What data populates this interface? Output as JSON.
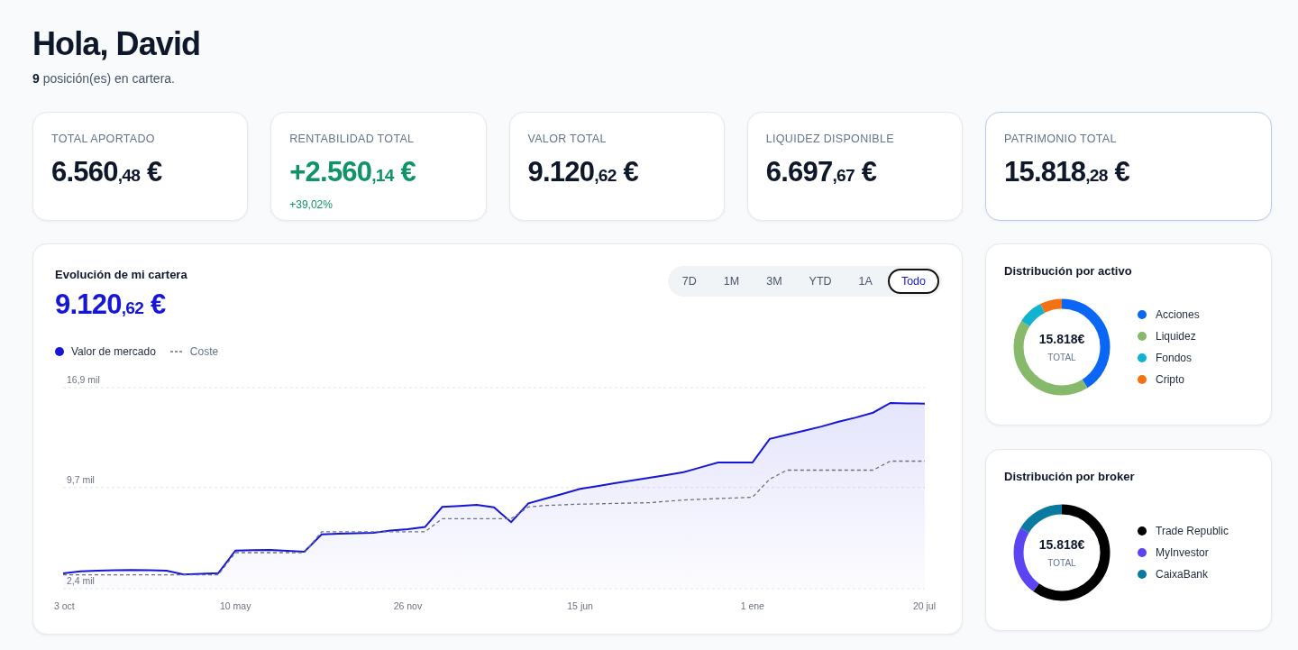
{
  "greeting": {
    "title": "Hola, David",
    "count": "9",
    "subtitle": "posición(es) en cartera."
  },
  "summary_cards": [
    {
      "label": "TOTAL APORTADO",
      "kind": "neutral",
      "highlighted": false,
      "amount": {
        "integer": "6.560",
        "decimals": ",48",
        "currency": "€"
      }
    },
    {
      "label": "RENTABILIDAD TOTAL",
      "kind": "positive",
      "highlighted": false,
      "amount": {
        "integer": "+2.560",
        "decimals": ",14",
        "currency": "€"
      },
      "change": "+39,02%"
    },
    {
      "label": "VALOR TOTAL",
      "kind": "neutral",
      "highlighted": false,
      "amount": {
        "integer": "9.120",
        "decimals": ",62",
        "currency": "€"
      }
    },
    {
      "label": "LIQUIDEZ DISPONIBLE",
      "kind": "neutral",
      "highlighted": false,
      "amount": {
        "integer": "6.697",
        "decimals": ",67",
        "currency": "€"
      }
    },
    {
      "label": "PATRIMONIO TOTAL",
      "kind": "neutral",
      "highlighted": true,
      "amount": {
        "integer": "15.818",
        "decimals": ",28",
        "currency": "€"
      }
    }
  ],
  "evolution": {
    "title": "Evolución de mi cartera",
    "amount": {
      "integer": "9.120",
      "decimals": ",62",
      "currency": "€"
    },
    "ranges": [
      {
        "label": "7D",
        "selected": false
      },
      {
        "label": "1M",
        "selected": false
      },
      {
        "label": "3M",
        "selected": false
      },
      {
        "label": "YTD",
        "selected": false
      },
      {
        "label": "1A",
        "selected": false
      },
      {
        "label": "Todo",
        "selected": true
      }
    ],
    "chart_data": {
      "type": "line",
      "categories": [
        "3 oct",
        null,
        null,
        null,
        null,
        null,
        null,
        null,
        null,
        null,
        "10 may",
        null,
        null,
        null,
        null,
        null,
        null,
        null,
        null,
        null,
        "26 nov",
        null,
        null,
        null,
        null,
        null,
        null,
        null,
        null,
        null,
        "15 jun",
        null,
        null,
        null,
        null,
        null,
        null,
        null,
        null,
        null,
        "1 ene",
        null,
        null,
        null,
        null,
        null,
        null,
        null,
        null,
        null,
        "20 jul"
      ],
      "series": [
        {
          "name": "Valor de mercado",
          "color": "#1616d6",
          "type": "area",
          "values": [
            3.5,
            3.65,
            3.7,
            3.73,
            3.75,
            3.73,
            3.7,
            3.43,
            3.47,
            3.52,
            5.15,
            5.18,
            5.19,
            5.13,
            5.07,
            6.32,
            6.36,
            6.4,
            6.44,
            6.6,
            6.7,
            6.85,
            8.3,
            8.37,
            8.44,
            8.27,
            7.2,
            8.55,
            8.9,
            9.25,
            9.6,
            9.8,
            10.0,
            10.2,
            10.4,
            10.6,
            10.8,
            11.15,
            11.5,
            11.5,
            11.5,
            13.2,
            13.5,
            13.8,
            14.1,
            14.45,
            14.75,
            15.1,
            15.8,
            15.77,
            15.75
          ]
        },
        {
          "name": "Coste",
          "color": "#6b7280",
          "type": "line",
          "line_style": "dashed",
          "values": [
            3.4,
            3.4,
            3.4,
            3.4,
            3.4,
            3.4,
            3.4,
            3.4,
            3.4,
            3.4,
            5.0,
            5.0,
            5.0,
            5.0,
            5.0,
            6.5,
            6.5,
            6.5,
            6.5,
            6.5,
            6.5,
            6.5,
            7.45,
            7.45,
            7.45,
            7.45,
            7.45,
            8.3,
            8.4,
            8.45,
            8.5,
            8.52,
            8.55,
            8.58,
            8.6,
            8.7,
            8.8,
            8.85,
            8.9,
            8.95,
            9.0,
            10.3,
            10.95,
            10.95,
            10.95,
            10.95,
            10.95,
            10.95,
            11.6,
            11.6,
            11.6
          ]
        }
      ],
      "ylim": [
        2.4,
        16.9
      ],
      "grid": true,
      "yticks": [
        {
          "value": 2.4,
          "label": "2,4 mil"
        },
        {
          "value": 9.7,
          "label": "9,7 mil"
        },
        {
          "value": 16.9,
          "label": "16,9 mil"
        }
      ]
    }
  },
  "distributions": [
    {
      "title": "Distribución por activo",
      "center_value": "15.818€",
      "center_label": "TOTAL",
      "legend": [
        {
          "label": "Acciones",
          "color": "#0a66f5"
        },
        {
          "label": "Liquidez",
          "color": "#86b96a"
        },
        {
          "label": "Fondos",
          "color": "#10b4cf"
        },
        {
          "label": "Cripto",
          "color": "#f47216"
        }
      ]
    },
    {
      "title": "Distribución por broker",
      "center_value": "15.818€",
      "center_label": "TOTAL",
      "legend": [
        {
          "label": "Trade Republic",
          "color": "#000000"
        },
        {
          "label": "MyInvestor",
          "color": "#5b45f2"
        },
        {
          "label": "CaixaBank",
          "color": "#0a7aa0"
        }
      ]
    }
  ]
}
